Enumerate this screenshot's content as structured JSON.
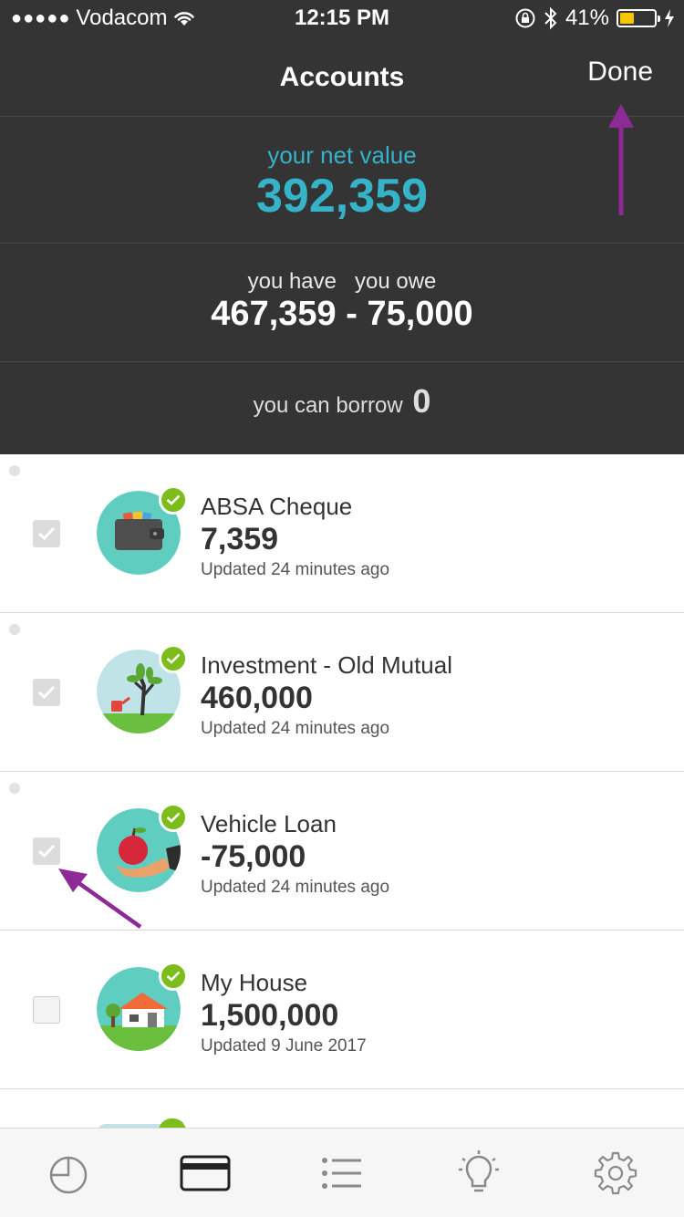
{
  "status_bar": {
    "carrier": "Vodacom",
    "time": "12:15 PM",
    "battery": "41%",
    "battery_fraction": 0.41
  },
  "nav": {
    "title": "Accounts",
    "done_label": "Done"
  },
  "summary": {
    "net_label": "your net value",
    "net_value": "392,359",
    "have_label": "you have",
    "owe_label": "you owe",
    "have_value": "467,359",
    "separator": "-",
    "owe_value": "75,000",
    "borrow_label": "you can borrow",
    "borrow_value": "0"
  },
  "accounts": [
    {
      "name": "ABSA Cheque",
      "amount": "7,359",
      "updated": "Updated 24 minutes ago",
      "checked": true,
      "icon": "wallet-icon"
    },
    {
      "name": "Investment - Old Mutual",
      "amount": "460,000",
      "updated": "Updated 24 minutes ago",
      "checked": true,
      "icon": "tree-icon"
    },
    {
      "name": "Vehicle Loan",
      "amount": "-75,000",
      "updated": "Updated 24 minutes ago",
      "checked": true,
      "icon": "apple-hand-icon"
    },
    {
      "name": "My House",
      "amount": "1,500,000",
      "updated": "Updated 9 June 2017",
      "checked": false,
      "icon": "house-icon"
    }
  ],
  "tabs": [
    {
      "icon": "pie-chart-icon",
      "active": false
    },
    {
      "icon": "card-icon",
      "active": true
    },
    {
      "icon": "list-icon",
      "active": false
    },
    {
      "icon": "lightbulb-icon",
      "active": false
    },
    {
      "icon": "gear-icon",
      "active": false
    }
  ],
  "colors": {
    "header_bg": "#343434",
    "accent_blue": "#34b3c9",
    "badge_green": "#7cbc1b",
    "annotation_purple": "#8e2a96"
  }
}
